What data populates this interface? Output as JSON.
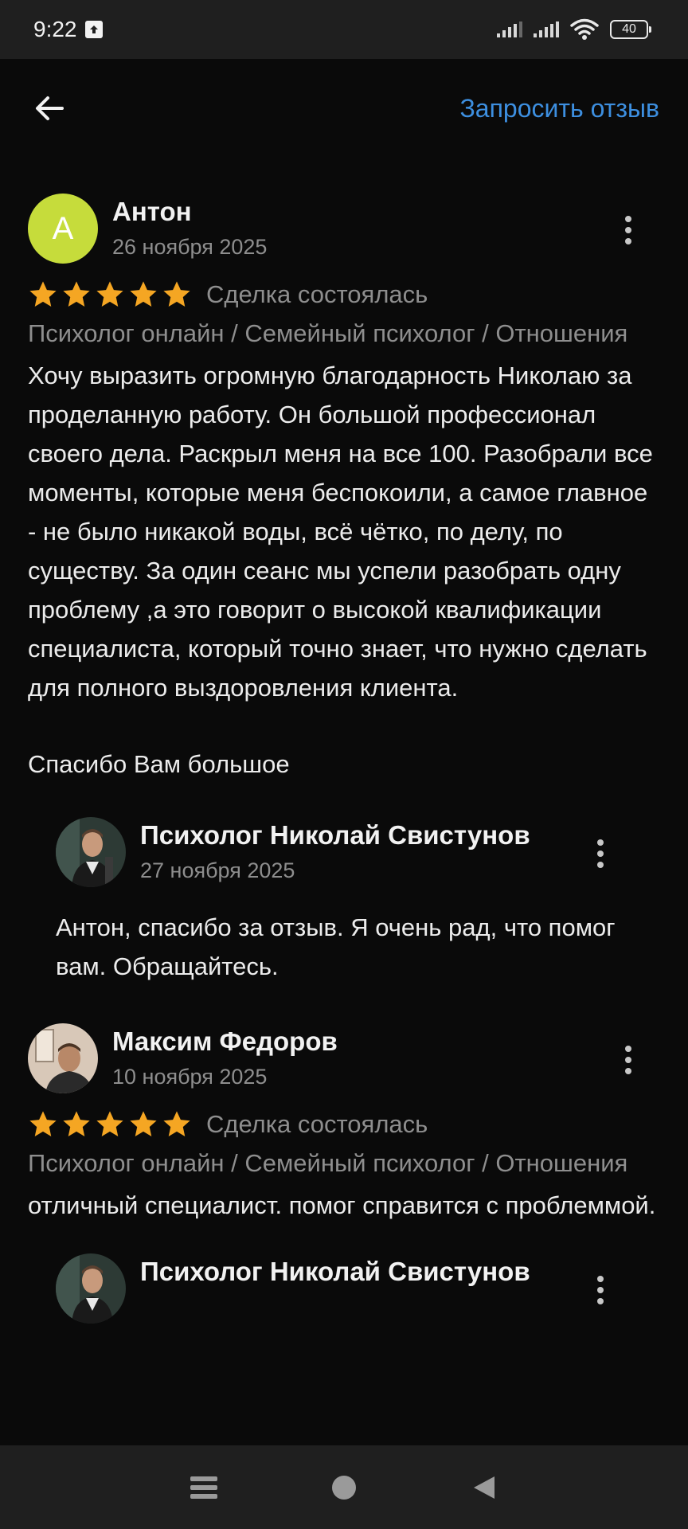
{
  "status_bar": {
    "time": "9:22",
    "battery": "40"
  },
  "header": {
    "back_icon": "arrow-left-icon",
    "request_review_label": "Запросить отзыв"
  },
  "reviews": [
    {
      "avatar_letter": "А",
      "avatar_color": "#c6dc3b",
      "author": "Антон",
      "date": "26 ноября 2025",
      "stars": 5,
      "deal_status": "Сделка состоялась",
      "category": "Психолог онлайн / Семейный психолог / Отношения",
      "text": "Хочу выразить огромную благодарность Николаю за проделанную работу. Он большой профессионал своего дела. Раскрыл меня на все 100. Разобрали все моменты, которые меня беспокоили, а самое главное - не было никакой воды, всё чётко, по делу, по существу. За один сеанс мы успели разобрать одну проблему ,а это говорит о высокой квалификации специалиста, который точно знает, что нужно сделать для полного выздоровления клиента.",
      "text_extra": "Спасибо Вам большое",
      "reply": {
        "author": "Психолог Николай Свистунов",
        "date": "27 ноября 2025",
        "text": "Антон, спасибо за отзыв. Я очень рад, что помог вам. Обращайтесь."
      }
    },
    {
      "author": "Максим Федоров",
      "date": "10 ноября 2025",
      "stars": 5,
      "deal_status": "Сделка состоялась",
      "category": "Психолог онлайн / Семейный психолог / Отношения",
      "text": "отличный специалист. помог справится с проблеммой.",
      "reply": {
        "author": "Психолог Николай Свистунов"
      }
    }
  ],
  "colors": {
    "accent": "#3d8fe0",
    "star": "#f5a623",
    "background": "#0a0a0a"
  }
}
